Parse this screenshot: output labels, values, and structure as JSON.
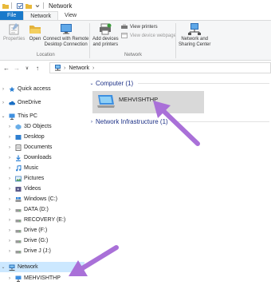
{
  "window": {
    "title": "Network"
  },
  "ribbon": {
    "tabs": [
      {
        "label": "File"
      },
      {
        "label": "Network"
      },
      {
        "label": "View"
      }
    ],
    "location_group": {
      "label": "Location",
      "properties": "Properties",
      "open": "Open",
      "connect_remote_line1": "Connect with Remote",
      "connect_remote_line2": "Desktop Connection"
    },
    "network_group": {
      "label": "Network",
      "add_devices_line1": "Add devices",
      "add_devices_line2": "and printers",
      "view_printers": "View printers",
      "view_device_webpage": "View device webpage",
      "sharing_center_line1": "Network and",
      "sharing_center_line2": "Sharing Center"
    }
  },
  "address": {
    "crumb": "Network",
    "back": "←",
    "forward": "→",
    "recent": "∨",
    "up": "↑"
  },
  "nav_pane": {
    "items": [
      {
        "label": "Quick access"
      },
      {
        "label": "OneDrive"
      },
      {
        "label": "This PC"
      },
      {
        "label": "3D Objects"
      },
      {
        "label": "Desktop"
      },
      {
        "label": "Documents"
      },
      {
        "label": "Downloads"
      },
      {
        "label": "Music"
      },
      {
        "label": "Pictures"
      },
      {
        "label": "Videos"
      },
      {
        "label": "Windows (C:)"
      },
      {
        "label": "DATA (D:)"
      },
      {
        "label": "RECOVERY (E:)"
      },
      {
        "label": "Drive (F:)"
      },
      {
        "label": "Drive (G:)"
      },
      {
        "label": "Drive J (J:)"
      },
      {
        "label": "Network"
      },
      {
        "label": "MEHVISHTHP"
      }
    ]
  },
  "content": {
    "computer_group": "Computer (1)",
    "computer_item": "MEHVISHTHP",
    "infrastructure_group": "Network Infrastructure (1)"
  },
  "colors": {
    "accent": "#1979ca",
    "arrow": "#a970d8",
    "selection": "#cce8ff"
  }
}
